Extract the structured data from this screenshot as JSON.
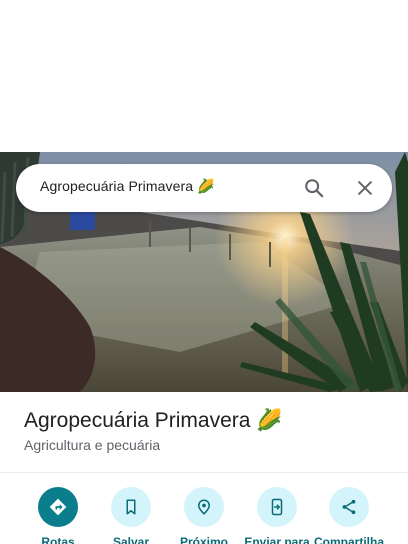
{
  "search": {
    "query": "Agropecuária Primavera 🌽"
  },
  "place": {
    "name": "Agropecuária Primavera 🌽",
    "category": "Agricultura e pecuária"
  },
  "actions": [
    {
      "label": "Rotas",
      "icon": "directions-icon"
    },
    {
      "label": "Salvar",
      "icon": "bookmark-icon"
    },
    {
      "label": "Próximo",
      "icon": "nearby-icon"
    },
    {
      "label": "Enviar para",
      "icon": "send-to-phone-icon"
    },
    {
      "label": "Compartilha",
      "icon": "share-icon"
    }
  ],
  "colors": {
    "accent": "#0a7e8c",
    "action_bg": "#d3f4fb",
    "action_text": "#0b6b77"
  }
}
